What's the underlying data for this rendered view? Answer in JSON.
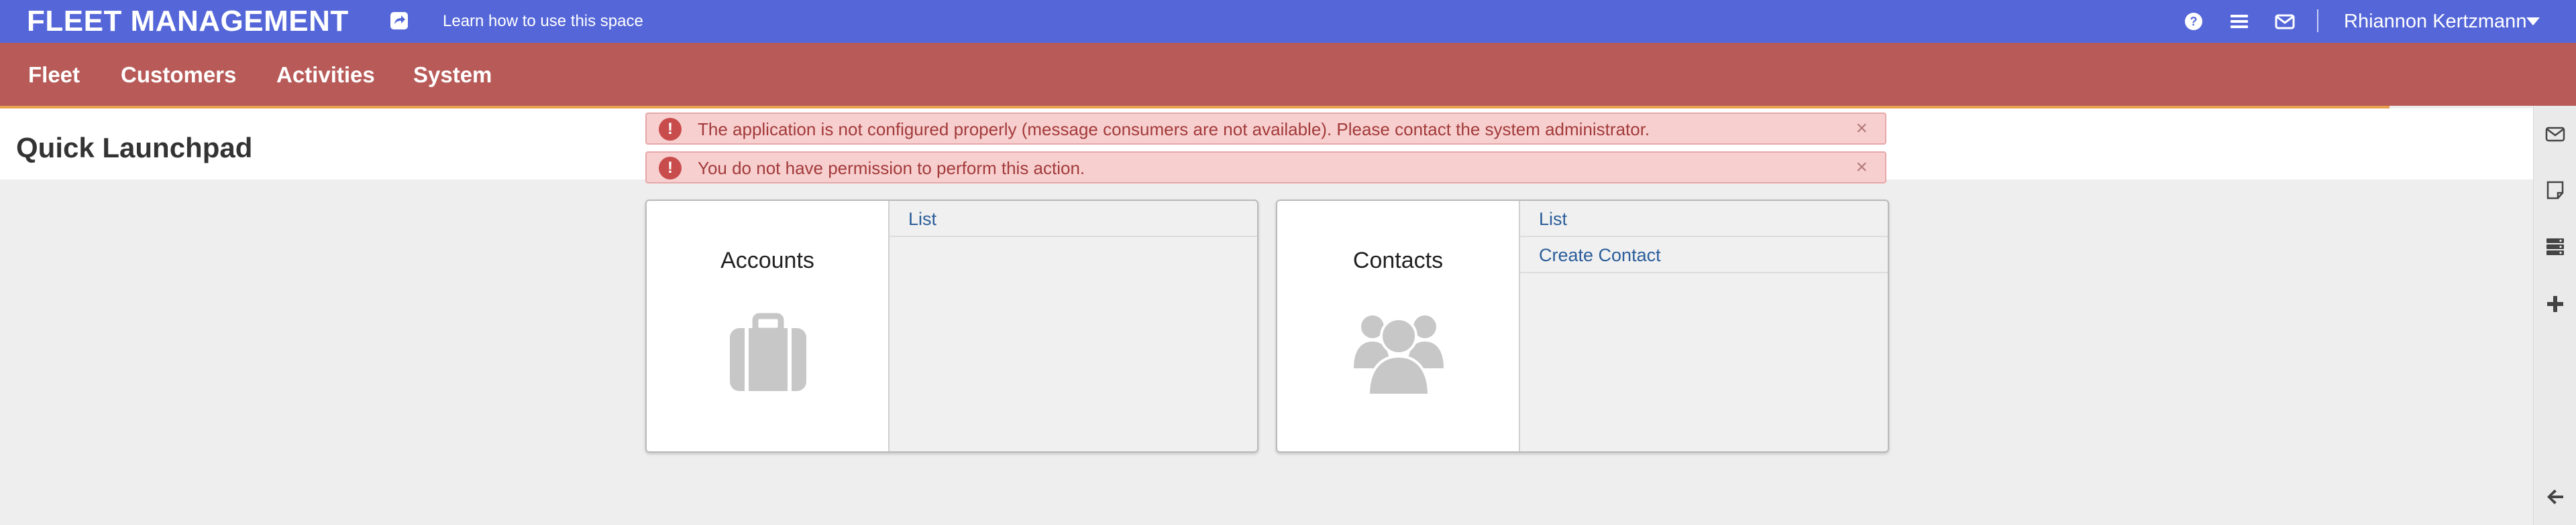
{
  "header": {
    "brand": "FLEET MANAGEMENT",
    "help_link": "Learn how to use this space",
    "help_icon": "share-icon",
    "icons": [
      "question-circle-icon",
      "menu-lines-icon",
      "envelope-icon"
    ],
    "user_name": "Rhiannon Kertzmann",
    "color": "#5567d8"
  },
  "nav": {
    "items": [
      "Fleet",
      "Customers",
      "Activities",
      "System"
    ],
    "color": "#b85b58",
    "accent": "#e8a24e"
  },
  "page": {
    "title": "Quick Launchpad"
  },
  "alerts": [
    {
      "text": "The application is not configured properly (message consumers are not available). Please contact the system administrator.",
      "close": "×"
    },
    {
      "text": "You do not have permission to perform this action.",
      "close": "×"
    }
  ],
  "cards": [
    {
      "title": "Accounts",
      "icon": "briefcase-icon",
      "links": [
        "List"
      ]
    },
    {
      "title": "Contacts",
      "icon": "users-group-icon",
      "links": [
        "List",
        "Create Contact"
      ]
    }
  ],
  "rail": {
    "icons": [
      "envelope-icon",
      "sticky-note-icon",
      "server-stack-icon",
      "plus-icon",
      "arrow-left-icon"
    ]
  }
}
